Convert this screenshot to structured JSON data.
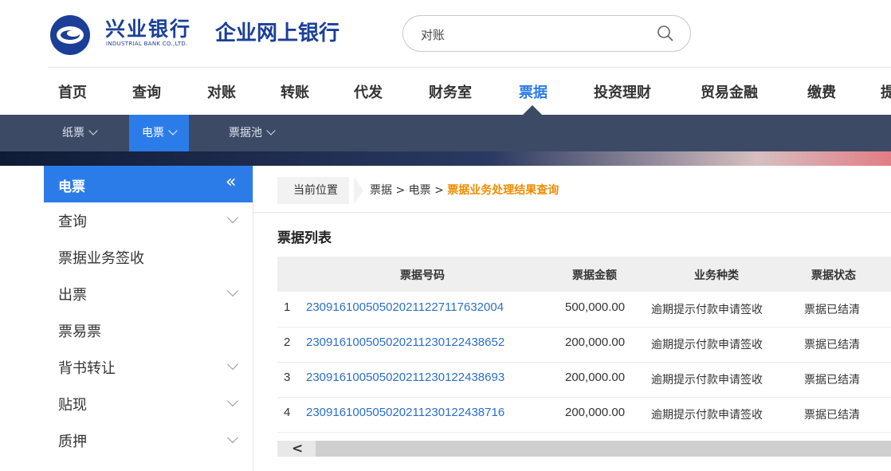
{
  "header": {
    "bank_name": "兴业银行",
    "bank_name_en": "INDUSTRIAL BANK CO.,LTD.",
    "service_name": "企业网上银行",
    "search": {
      "value": "对账"
    },
    "brand_color": "#1b3f97"
  },
  "main_nav": {
    "items": [
      {
        "label": "首页"
      },
      {
        "label": "查询"
      },
      {
        "label": "对账"
      },
      {
        "label": "转账"
      },
      {
        "label": "代发"
      },
      {
        "label": "财务室"
      },
      {
        "label": "票据",
        "active": true
      },
      {
        "label": "投资理财"
      },
      {
        "label": "贸易金融"
      },
      {
        "label": "缴费"
      },
      {
        "label": "提"
      }
    ]
  },
  "sub_nav": {
    "items": [
      {
        "label": "纸票"
      },
      {
        "label": "电票",
        "active": true
      },
      {
        "label": "票据池"
      }
    ]
  },
  "sidebar": {
    "title": "电票",
    "collapse_glyph": "«",
    "items": [
      {
        "label": "查询",
        "expandable": true
      },
      {
        "label": "票据业务签收",
        "expandable": false
      },
      {
        "label": "出票",
        "expandable": true
      },
      {
        "label": "票易票",
        "expandable": false
      },
      {
        "label": "背书转让",
        "expandable": true
      },
      {
        "label": "贴现",
        "expandable": true
      },
      {
        "label": "质押",
        "expandable": true
      }
    ]
  },
  "breadcrumb": {
    "current_label": "当前位置",
    "path_prefix": "票据 > 电票 > ",
    "page": "票据业务处理结果查询"
  },
  "list": {
    "title": "票据列表",
    "columns": [
      "",
      "票据号码",
      "票据金额",
      "业务种类",
      "票据状态"
    ],
    "rows": [
      {
        "idx": "1",
        "number": "230916100505020211227117632004",
        "amount": "500,000.00",
        "type": "逾期提示付款申请签收",
        "status": "票据已结清"
      },
      {
        "idx": "2",
        "number": "230916100505020211230122438652",
        "amount": "200,000.00",
        "type": "逾期提示付款申请签收",
        "status": "票据已结清"
      },
      {
        "idx": "3",
        "number": "230916100505020211230122438693",
        "amount": "200,000.00",
        "type": "逾期提示付款申请签收",
        "status": "票据已结清"
      },
      {
        "idx": "4",
        "number": "230916100505020211230122438716",
        "amount": "200,000.00",
        "type": "逾期提示付款申请签收",
        "status": "票据已结清"
      }
    ]
  },
  "scrollbar": {
    "left_glyph": "<"
  },
  "colors": {
    "accent": "#2b7ce9",
    "subnav_bg": "#3c4a66",
    "highlight": "#f08c00",
    "link": "#2b6fc9"
  }
}
